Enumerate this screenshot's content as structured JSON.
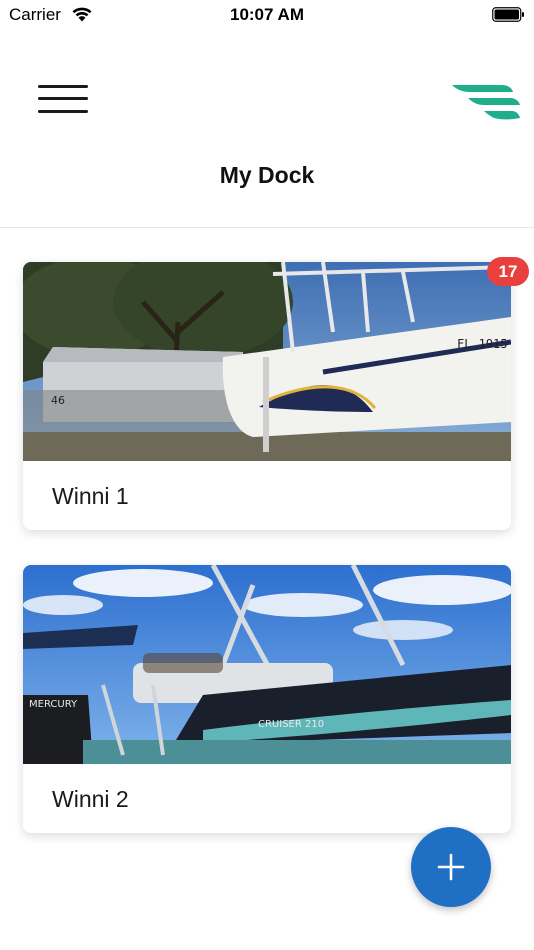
{
  "status_bar": {
    "carrier": "Carrier",
    "time": "10:07 AM",
    "wifi_icon": "wifi-icon",
    "battery_icon": "battery-icon"
  },
  "header": {
    "menu_icon": "hamburger-menu-icon",
    "logo_icon": "brand-wing-logo",
    "title": "My Dock",
    "logo_color": "#1fae8a"
  },
  "boats": [
    {
      "name": "Winni 1",
      "badge": "17",
      "photo": "center-console boat on trailer"
    },
    {
      "name": "Winni 2",
      "badge": "",
      "photo": "pontoon boat on lake"
    }
  ],
  "fab": {
    "icon": "plus-icon",
    "color": "#1f6fc4"
  },
  "colors": {
    "badge": "#e8403d",
    "accent": "#1f6fc4"
  }
}
